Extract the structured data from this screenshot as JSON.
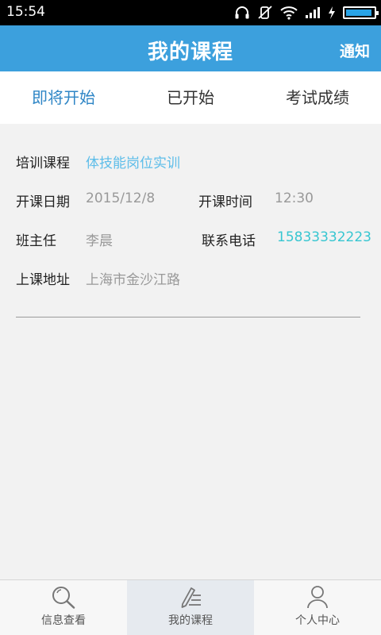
{
  "status_bar": {
    "time": "15:54",
    "icons": [
      "headphones-icon",
      "mute-icon",
      "wifi-icon",
      "signal-icon",
      "charging-icon",
      "battery-icon"
    ],
    "battery_level": 0.95,
    "battery_color": "#29a3e6"
  },
  "header": {
    "title": "我的课程",
    "notify": "通知",
    "color": "#3ca0dd"
  },
  "tabs": [
    {
      "label": "即将开始",
      "active": true
    },
    {
      "label": "已开始",
      "active": false
    },
    {
      "label": "考试成绩",
      "active": false
    }
  ],
  "course": {
    "name_label": "培训课程",
    "name": "体技能岗位实训",
    "date_label": "开课日期",
    "date": "2015/12/8",
    "time_label": "开课时间",
    "time": "12:30",
    "teacher_label": "班主任",
    "teacher": "李晨",
    "phone_label": "联系电话",
    "phone": "15833332223",
    "address_label": "上课地址",
    "address": "上海市金沙江路"
  },
  "bottom_nav": [
    {
      "label": "信息查看",
      "icon": "search-icon",
      "active": false
    },
    {
      "label": "我的课程",
      "icon": "edit-list-icon",
      "active": true
    },
    {
      "label": "个人中心",
      "icon": "person-icon",
      "active": false
    }
  ]
}
